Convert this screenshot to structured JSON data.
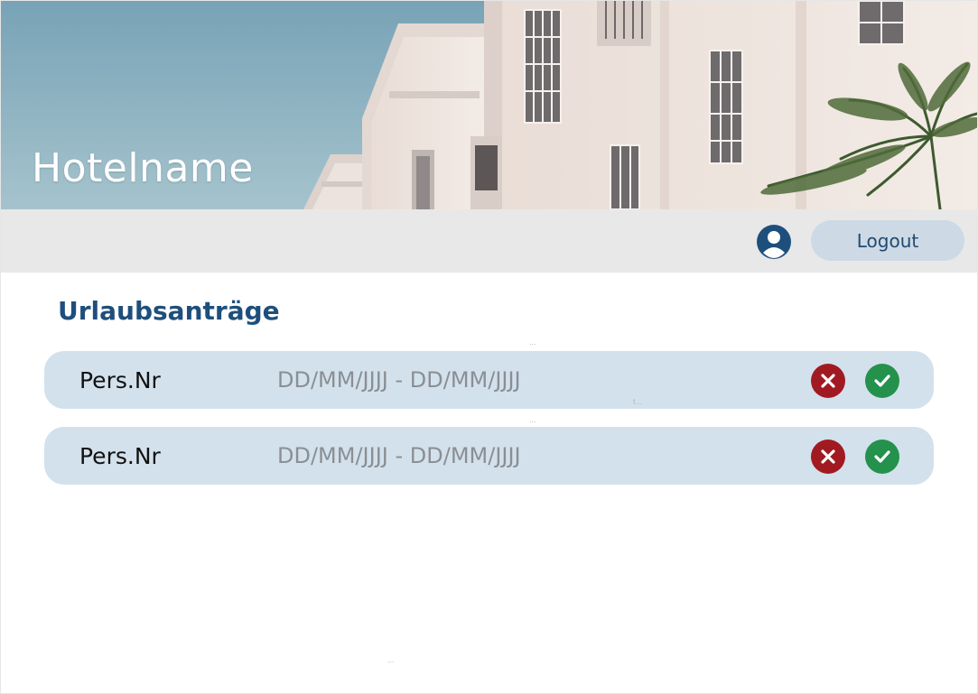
{
  "header": {
    "hotel_name": "Hotelname"
  },
  "toolbar": {
    "user_icon": "user-circle-icon",
    "logout_label": "Logout"
  },
  "main": {
    "title": "Urlaubsanträge",
    "requests": [
      {
        "pers_nr": "Pers.Nr",
        "date_range": "DD/MM/JJJJ - DD/MM/JJJJ",
        "reject_icon": "close-icon",
        "approve_icon": "check-icon"
      },
      {
        "pers_nr": "Pers.Nr",
        "date_range": "DD/MM/JJJJ - DD/MM/JJJJ",
        "reject_icon": "close-icon",
        "approve_icon": "check-icon"
      }
    ]
  },
  "artifacts": {
    "dots_a": "...",
    "t_a": "t...",
    "dots_b": "..."
  },
  "colors": {
    "primary_blue": "#1e4f7c",
    "row_background": "#d3e1ec",
    "reject_red": "#a11a22",
    "approve_green": "#24924c",
    "toolbar_gray": "#e8e8e8"
  }
}
